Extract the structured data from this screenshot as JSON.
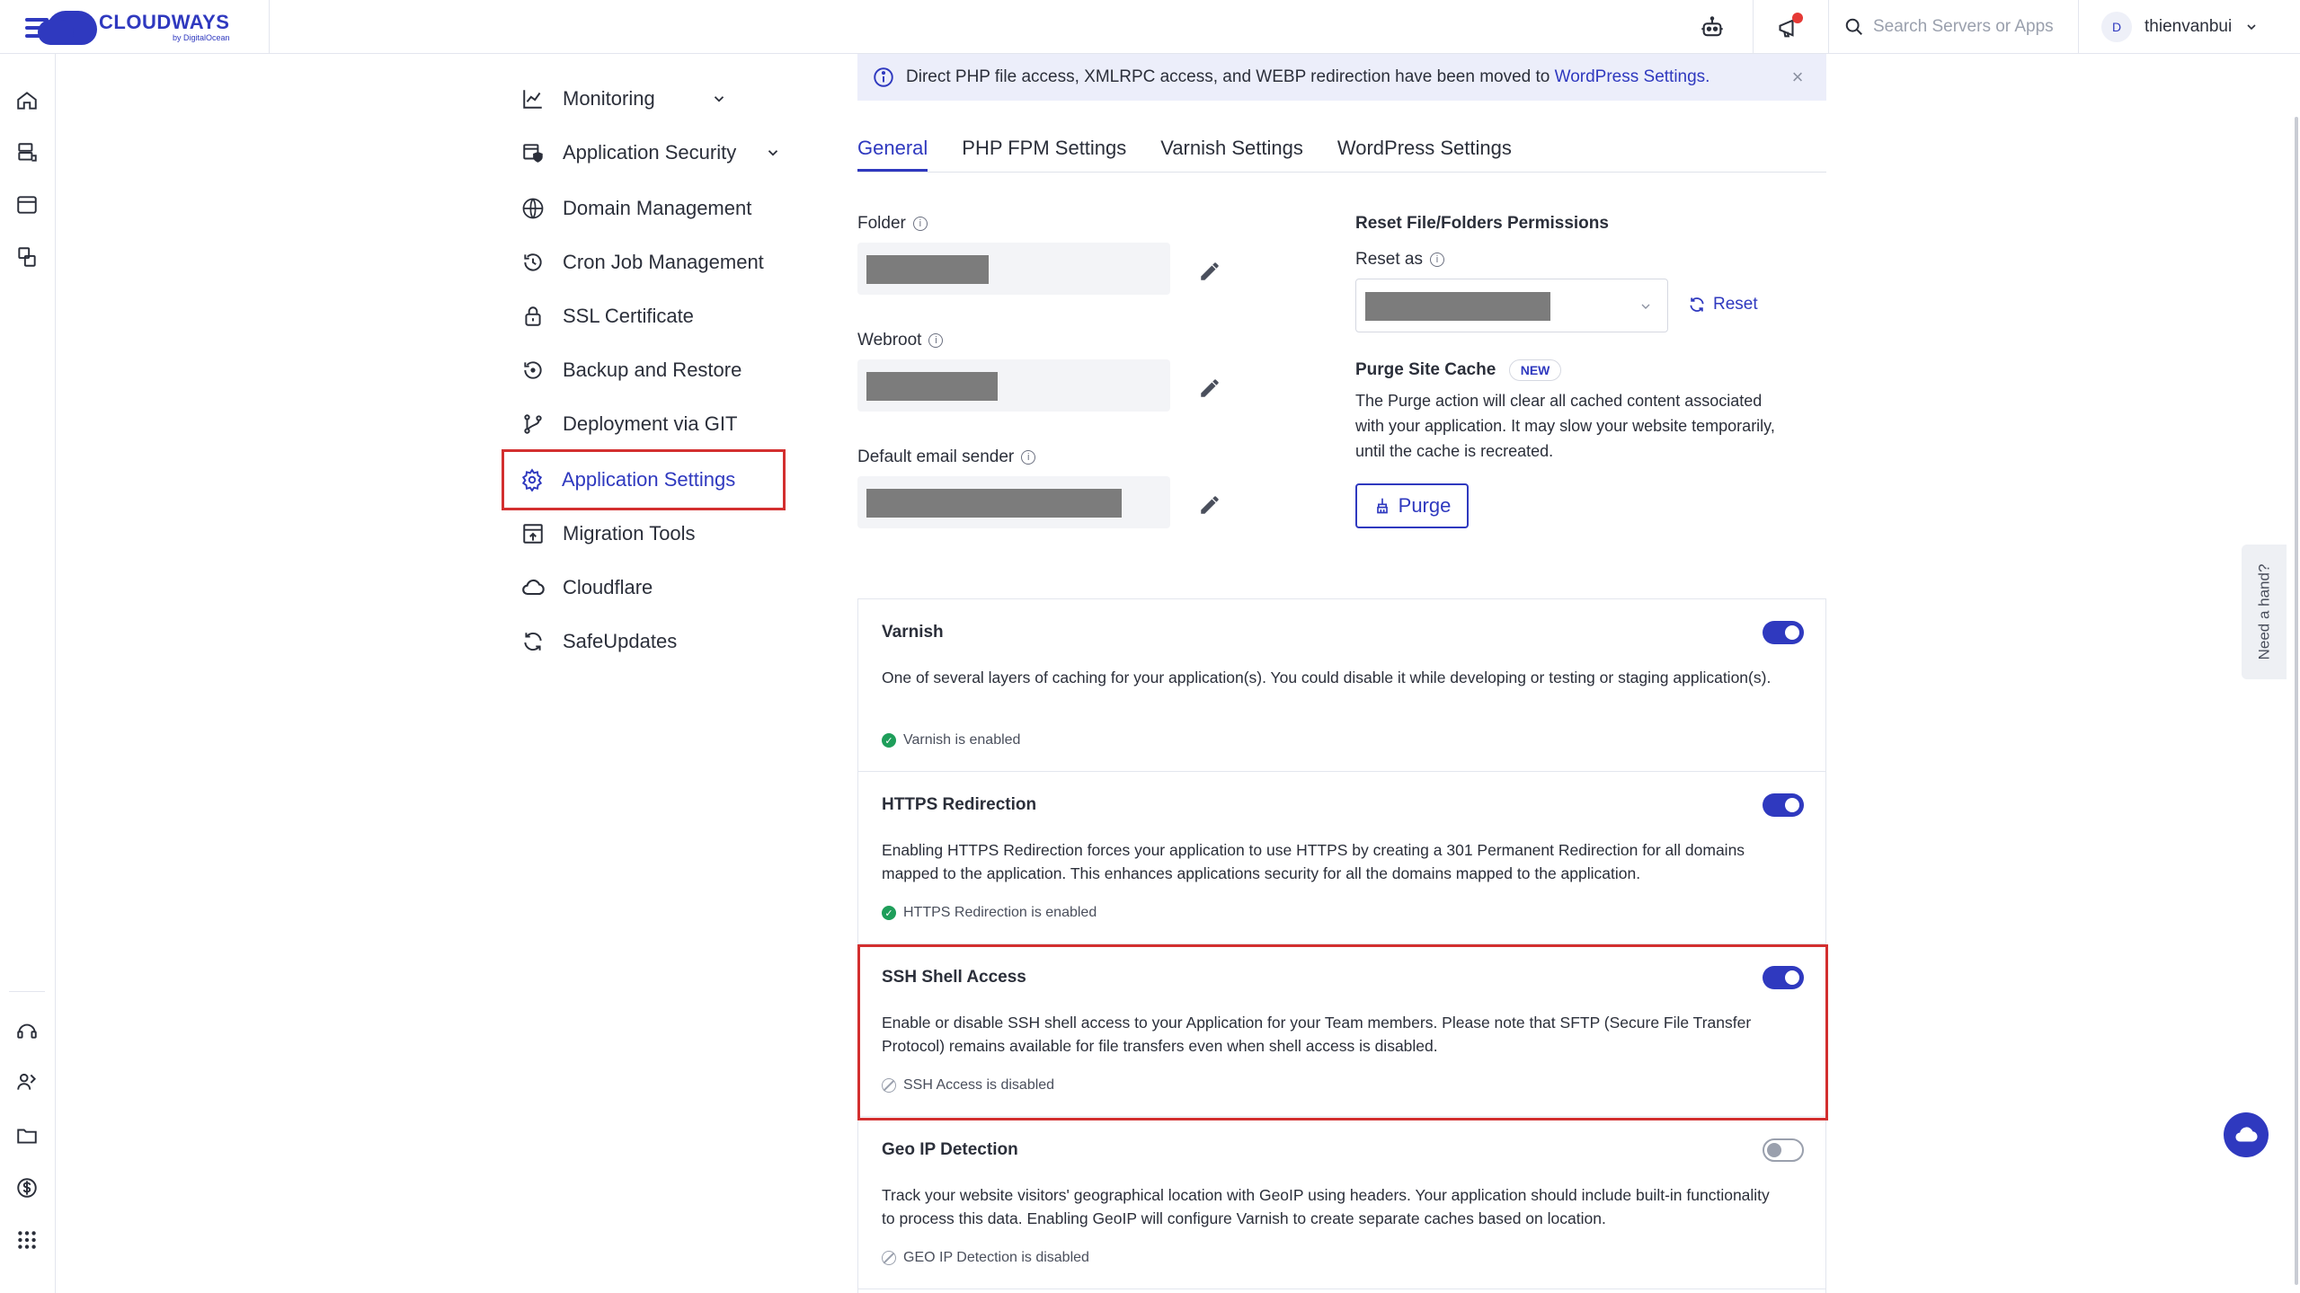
{
  "brand": {
    "name": "CLOUDWAYS",
    "by": "by DigitalOcean",
    "accent": "#2f39bf"
  },
  "header": {
    "search_placeholder": "Search Servers or Apps",
    "user_initial": "D",
    "username": "thienvanbui"
  },
  "menu": {
    "items": [
      {
        "label": "Monitoring",
        "icon": "chart-line-icon",
        "has_chevron": true
      },
      {
        "label": "Application Security",
        "icon": "shield-app-icon",
        "has_chevron": true
      },
      {
        "label": "Domain Management",
        "icon": "www-globe-icon",
        "has_chevron": false
      },
      {
        "label": "Cron Job Management",
        "icon": "clock-history-icon",
        "has_chevron": false
      },
      {
        "label": "SSL Certificate",
        "icon": "lock-icon",
        "has_chevron": false
      },
      {
        "label": "Backup and Restore",
        "icon": "restore-icon",
        "has_chevron": false
      },
      {
        "label": "Deployment via GIT",
        "icon": "git-branch-icon",
        "has_chevron": false
      },
      {
        "label": "Application Settings",
        "icon": "gear-icon",
        "has_chevron": false,
        "active": true
      },
      {
        "label": "Migration Tools",
        "icon": "migrate-icon",
        "has_chevron": false
      },
      {
        "label": "Cloudflare",
        "icon": "cloud-icon",
        "has_chevron": false
      },
      {
        "label": "SafeUpdates",
        "icon": "sync-icon",
        "has_chevron": false
      }
    ]
  },
  "banner": {
    "text": "Direct PHP file access, XMLRPC access, and WEBP redirection have been moved to",
    "link": "WordPress Settings."
  },
  "tabs": [
    {
      "label": "General",
      "active": true
    },
    {
      "label": "PHP FPM Settings",
      "active": false
    },
    {
      "label": "Varnish Settings",
      "active": false
    },
    {
      "label": "WordPress Settings",
      "active": false
    }
  ],
  "fields": {
    "folder_label": "Folder",
    "webroot_label": "Webroot",
    "email_label": "Default email sender"
  },
  "permissions": {
    "title": "Reset File/Folders Permissions",
    "reset_as_label": "Reset as",
    "reset_link": "Reset"
  },
  "purge": {
    "title": "Purge Site Cache",
    "badge": "NEW",
    "desc_1": "The Purge action will clear all cached content associated",
    "desc_2": "with your application. It may slow your website temporarily,",
    "desc_3": "until the cache is recreated.",
    "button": "Purge"
  },
  "cards": [
    {
      "title": "Varnish",
      "desc": "One of several layers of caching for your application(s). You could disable it while developing or testing or staging application(s).",
      "status": "Varnish is enabled",
      "enabled": true
    },
    {
      "title": "HTTPS Redirection",
      "desc": "Enabling HTTPS Redirection forces your application to use HTTPS by creating a 301 Permanent Redirection for all domains mapped to the application. This enhances applications security for all the domains mapped to the application.",
      "status": "HTTPS Redirection is enabled",
      "enabled": true
    },
    {
      "title": "SSH Shell Access",
      "desc": "Enable or disable SSH shell access to your Application for your Team members. Please note that SFTP (Secure File Transfer Protocol) remains available for file transfers even when shell access is disabled.",
      "status": "SSH Access is disabled",
      "enabled": true
    },
    {
      "title": "Geo IP Detection",
      "desc": "Track your website visitors' geographical location with GeoIP using headers. Your application should include built-in functionality to process this data. Enabling GeoIP will configure Varnish to create separate caches based on location.",
      "status": "GEO IP Detection is disabled",
      "enabled": false
    }
  ],
  "help": {
    "need_hand": "Need a hand?"
  }
}
